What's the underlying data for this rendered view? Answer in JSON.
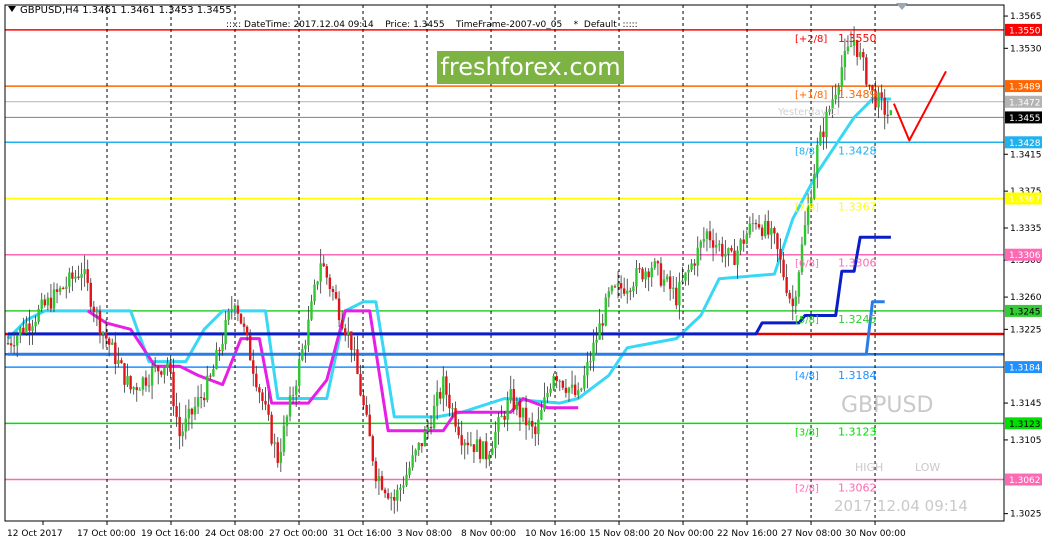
{
  "header": {
    "symbol_line": "GBPUSD,H4  1.3461 1.3461 1.3453 1.3455",
    "info_line": "::::: DateTime: 2017.12.04 09:14    Price: 1.3455    TimeFrame-2007-v0_05    *  Default  :::::"
  },
  "watermark": "freshforex.com",
  "symbol_big": "GBPUSD",
  "high_label": "HIGH",
  "low_label": "LOW",
  "timestamp": "2017.12.04 09:14",
  "yesterday_label": "Yesterday Cl",
  "colors": {
    "bull": "#2ec82e",
    "bear": "#e0141a",
    "wick": "#333333",
    "grid": "#000000",
    "axis_text": "#000000"
  },
  "chart_data": {
    "type": "candlestick",
    "ylim": [
      1.3017,
      1.3577
    ],
    "yticks": [
      1.3565,
      1.353,
      1.3489,
      1.3472,
      1.3455,
      1.3428,
      1.3415,
      1.3375,
      1.3367,
      1.3335,
      1.3306,
      1.33,
      1.326,
      1.3245,
      1.3225,
      1.3184,
      1.3145,
      1.3123,
      1.3105,
      1.3062,
      1.3025
    ],
    "yticks_plain": [
      "1.3565",
      "1.3530",
      "1.3415",
      "1.3375",
      "1.3335",
      "1.3300",
      "1.3260",
      "1.3225",
      "1.3145",
      "1.3105",
      "1.3025"
    ],
    "xticks": [
      "12 Oct 2017",
      "17 Oct 00:00",
      "19 Oct 16:00",
      "24 Oct 08:00",
      "27 Oct 00:00",
      "31 Oct 16:00",
      "3 Nov 08:00",
      "8 Nov 00:00",
      "10 Nov 16:00",
      "15 Nov 08:00",
      "20 Nov 00:00",
      "22 Nov 16:00",
      "27 Nov 08:00",
      "30 Nov 00:00"
    ],
    "current_price": 1.3455,
    "price_tags": [
      {
        "value": 1.355,
        "text": "1.3550",
        "color": "#ff0000",
        "text_color": "#ffffff"
      },
      {
        "value": 1.3489,
        "text": "1.3489",
        "color": "#ff6600",
        "text_color": "#ffffff"
      },
      {
        "value": 1.3472,
        "text": "1.3472",
        "color": "#b4b4b4",
        "text_color": "#ffffff"
      },
      {
        "value": 1.3455,
        "text": "1.3455",
        "color": "#000000",
        "text_color": "#ffffff"
      },
      {
        "value": 1.3428,
        "text": "1.3428",
        "color": "#20b2f0",
        "text_color": "#ffffff"
      },
      {
        "value": 1.3367,
        "text": "1.3367",
        "color": "#ffff00",
        "text_color": "#ffffff"
      },
      {
        "value": 1.3306,
        "text": "1.3306",
        "color": "#ff69b4",
        "text_color": "#ffffff"
      },
      {
        "value": 1.3245,
        "text": "1.3245",
        "color": "#32cd32",
        "text_color": "#000000"
      },
      {
        "value": 1.3184,
        "text": "1.3184",
        "color": "#1e90ff",
        "text_color": "#ffffff"
      },
      {
        "value": 1.3123,
        "text": "1.3123",
        "color": "#00e000",
        "text_color": "#000000"
      },
      {
        "value": 1.3062,
        "text": "1.3062",
        "color": "#ff69b4",
        "text_color": "#ffffff"
      }
    ],
    "murrey_levels": [
      {
        "label": "[+2/8]",
        "value": 1.355,
        "text": "1.3550",
        "color": "#ff0000"
      },
      {
        "label": "[+1/8]",
        "value": 1.3489,
        "text": "1.3489",
        "color": "#ff6600"
      },
      {
        "label": "[8/8]",
        "value": 1.3428,
        "text": "1.3428",
        "color": "#20b2f0"
      },
      {
        "label": "[7/8]",
        "value": 1.3367,
        "text": "1.3367",
        "color": "#ffff00"
      },
      {
        "label": "[6/8]",
        "value": 1.3306,
        "text": "1.3306",
        "color": "#ff69b4"
      },
      {
        "label": "[5/8]",
        "value": 1.3245,
        "text": "1.3245",
        "color": "#32cd32"
      },
      {
        "label": "[4/8]",
        "value": 1.3184,
        "text": "1.3184",
        "color": "#1e90ff"
      },
      {
        "label": "[3/8]",
        "value": 1.3123,
        "text": "1.3123",
        "color": "#00e000"
      },
      {
        "label": "[2/8]",
        "value": 1.3062,
        "text": "1.3062",
        "color": "#ff69b4"
      }
    ],
    "extra_lines": [
      {
        "value": 1.3472,
        "color": "#b4b4b4"
      },
      {
        "value": 1.3455,
        "color": "#808080"
      },
      {
        "value": 1.322,
        "color": "#e00000"
      },
      {
        "value": 1.3198,
        "color": "#1e78e6"
      }
    ],
    "anchors": [
      {
        "x": 0,
        "y": 1.321
      },
      {
        "x": 18,
        "y": 1.327
      },
      {
        "x": 24,
        "y": 1.329
      },
      {
        "x": 30,
        "y": 1.323
      },
      {
        "x": 40,
        "y": 1.316
      },
      {
        "x": 52,
        "y": 1.319
      },
      {
        "x": 56,
        "y": 1.311
      },
      {
        "x": 66,
        "y": 1.317
      },
      {
        "x": 74,
        "y": 1.326
      },
      {
        "x": 82,
        "y": 1.316
      },
      {
        "x": 88,
        "y": 1.3085
      },
      {
        "x": 98,
        "y": 1.323
      },
      {
        "x": 102,
        "y": 1.33
      },
      {
        "x": 112,
        "y": 1.321
      },
      {
        "x": 120,
        "y": 1.307
      },
      {
        "x": 126,
        "y": 1.304
      },
      {
        "x": 136,
        "y": 1.311
      },
      {
        "x": 142,
        "y": 1.3165
      },
      {
        "x": 148,
        "y": 1.311
      },
      {
        "x": 156,
        "y": 1.309
      },
      {
        "x": 164,
        "y": 1.315
      },
      {
        "x": 172,
        "y": 1.311
      },
      {
        "x": 178,
        "y": 1.318
      },
      {
        "x": 186,
        "y": 1.315
      },
      {
        "x": 196,
        "y": 1.326
      },
      {
        "x": 210,
        "y": 1.3295
      },
      {
        "x": 218,
        "y": 1.326
      },
      {
        "x": 228,
        "y": 1.333
      },
      {
        "x": 236,
        "y": 1.33
      },
      {
        "x": 244,
        "y": 1.3345
      },
      {
        "x": 250,
        "y": 1.332
      },
      {
        "x": 256,
        "y": 1.325
      },
      {
        "x": 264,
        "y": 1.342
      },
      {
        "x": 272,
        "y": 1.351
      },
      {
        "x": 276,
        "y": 1.354
      },
      {
        "x": 282,
        "y": 1.348
      },
      {
        "x": 288,
        "y": 1.3455
      }
    ],
    "overlays": {
      "cyan": {
        "color": "#38d8f5",
        "points": [
          [
            0,
            1.3215
          ],
          [
            6,
            1.3235
          ],
          [
            12,
            1.3245
          ],
          [
            40,
            1.3245
          ],
          [
            46,
            1.319
          ],
          [
            58,
            1.319
          ],
          [
            64,
            1.3225
          ],
          [
            70,
            1.3245
          ],
          [
            84,
            1.3245
          ],
          [
            88,
            1.315
          ],
          [
            104,
            1.315
          ],
          [
            110,
            1.3245
          ],
          [
            116,
            1.3255
          ],
          [
            120,
            1.3255
          ],
          [
            126,
            1.313
          ],
          [
            140,
            1.313
          ],
          [
            148,
            1.3135
          ],
          [
            162,
            1.315
          ],
          [
            180,
            1.3145
          ],
          [
            186,
            1.315
          ],
          [
            196,
            1.3175
          ],
          [
            202,
            1.3205
          ],
          [
            218,
            1.3215
          ],
          [
            226,
            1.324
          ],
          [
            232,
            1.328
          ],
          [
            250,
            1.3285
          ],
          [
            256,
            1.3345
          ],
          [
            264,
            1.3395
          ],
          [
            270,
            1.3425
          ],
          [
            276,
            1.3455
          ],
          [
            282,
            1.3475
          ],
          [
            288,
            1.3475
          ]
        ]
      },
      "magenta": {
        "color": "#e61ee6",
        "points": [
          [
            26,
            1.3245
          ],
          [
            32,
            1.3232
          ],
          [
            40,
            1.3225
          ],
          [
            48,
            1.3185
          ],
          [
            56,
            1.3185
          ],
          [
            62,
            1.3175
          ],
          [
            70,
            1.3165
          ],
          [
            76,
            1.3215
          ],
          [
            82,
            1.3215
          ],
          [
            86,
            1.3145
          ],
          [
            98,
            1.3145
          ],
          [
            104,
            1.317
          ],
          [
            110,
            1.3245
          ],
          [
            118,
            1.3245
          ],
          [
            124,
            1.3115
          ],
          [
            142,
            1.3115
          ],
          [
            146,
            1.3135
          ],
          [
            164,
            1.3135
          ],
          [
            168,
            1.315
          ],
          [
            176,
            1.314
          ],
          [
            186,
            1.314
          ]
        ]
      },
      "navy": {
        "color": "#0a1ec8",
        "points": [
          [
            0,
            1.322
          ],
          [
            244,
            1.322
          ],
          [
            246,
            1.3232
          ],
          [
            258,
            1.3232
          ],
          [
            260,
            1.324
          ],
          [
            270,
            1.324
          ],
          [
            272,
            1.3288
          ],
          [
            276,
            1.3288
          ],
          [
            278,
            1.3325
          ],
          [
            288,
            1.3325
          ]
        ]
      },
      "blue": {
        "color": "#2a7de8",
        "points": [
          [
            0,
            1.3198
          ],
          [
            280,
            1.3198
          ],
          [
            282,
            1.3255
          ],
          [
            286,
            1.3255
          ]
        ]
      },
      "forecast": {
        "color": "#ff0000",
        "points": [
          [
            289,
            1.347
          ],
          [
            294,
            1.343
          ],
          [
            306,
            1.3505
          ]
        ]
      }
    }
  }
}
